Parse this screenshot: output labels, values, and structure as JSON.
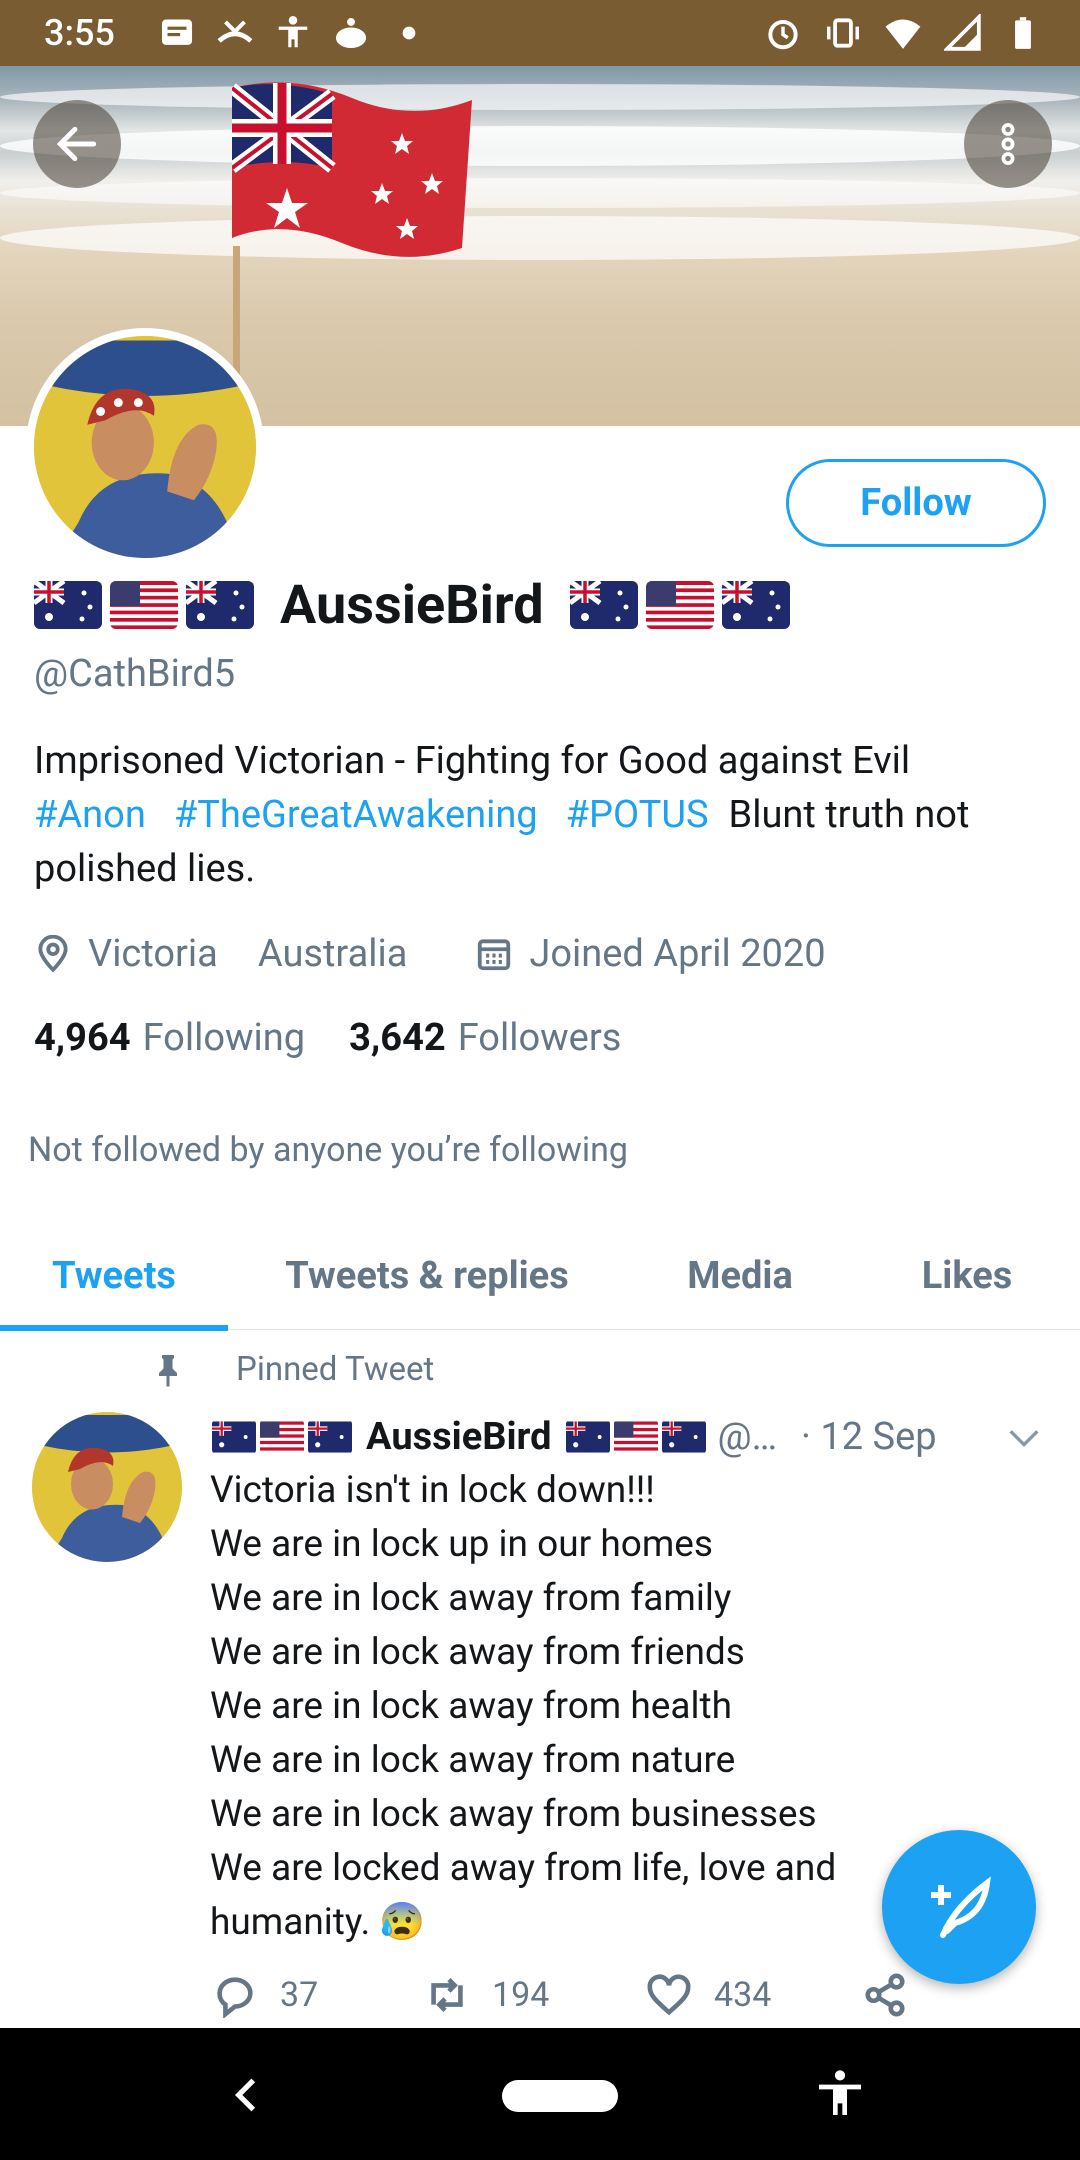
{
  "status_bar": {
    "time": "3:55",
    "left_icons": [
      "message-icon",
      "missed-call-icon",
      "accessibility-icon",
      "cake-icon",
      "dot-icon"
    ],
    "right_icons": [
      "alarm-icon",
      "vibrate-icon",
      "wifi-icon",
      "signal-icon",
      "battery-icon"
    ]
  },
  "header": {
    "back_icon": "arrow-left-icon",
    "more_icon": "more-vertical-icon"
  },
  "profile": {
    "follow_label": "Follow",
    "display_name": "AussieBird",
    "name_flags": [
      "au-flag",
      "us-flag",
      "au-flag"
    ],
    "handle": "@CathBird5",
    "bio_line1": "Imprisoned Victorian - Fighting for Good against Evil",
    "bio_tags": [
      "#Anon",
      "#TheGreatAwakening",
      "#POTUS"
    ],
    "bio_rest": "Blunt truth not polished lies.",
    "location_city": "Victoria",
    "location_country": "Australia",
    "joined": "Joined April 2020",
    "following_count": "4,964",
    "following_label": "Following",
    "followers_count": "3,642",
    "followers_label": "Followers",
    "not_followed": "Not followed by anyone you’re following"
  },
  "tabs": [
    {
      "label": "Tweets",
      "active": true
    },
    {
      "label": "Tweets & replies",
      "active": false
    },
    {
      "label": "Media",
      "active": false
    },
    {
      "label": "Likes",
      "active": false
    }
  ],
  "pinned_tweet": {
    "pinned_label": "Pinned Tweet",
    "author_name": "AussieBird",
    "author_handle": "@…",
    "date": "· 12 Sep",
    "text": "Victoria isn't in lock down!!!\nWe are in lock up in our homes\nWe are in lock away from family\nWe are in lock away from friends\nWe are in lock away from health\nWe are in lock away from nature\nWe are in lock away from businesses\nWe are locked away from life, love and\nhumanity. 😰",
    "replies": "37",
    "retweets": "194",
    "likes": "434"
  },
  "fab": {
    "icon": "compose-tweet-icon"
  },
  "colors": {
    "accent": "#1da1f2",
    "secondary_text": "#657786",
    "status_bar": "#7a5c33"
  }
}
